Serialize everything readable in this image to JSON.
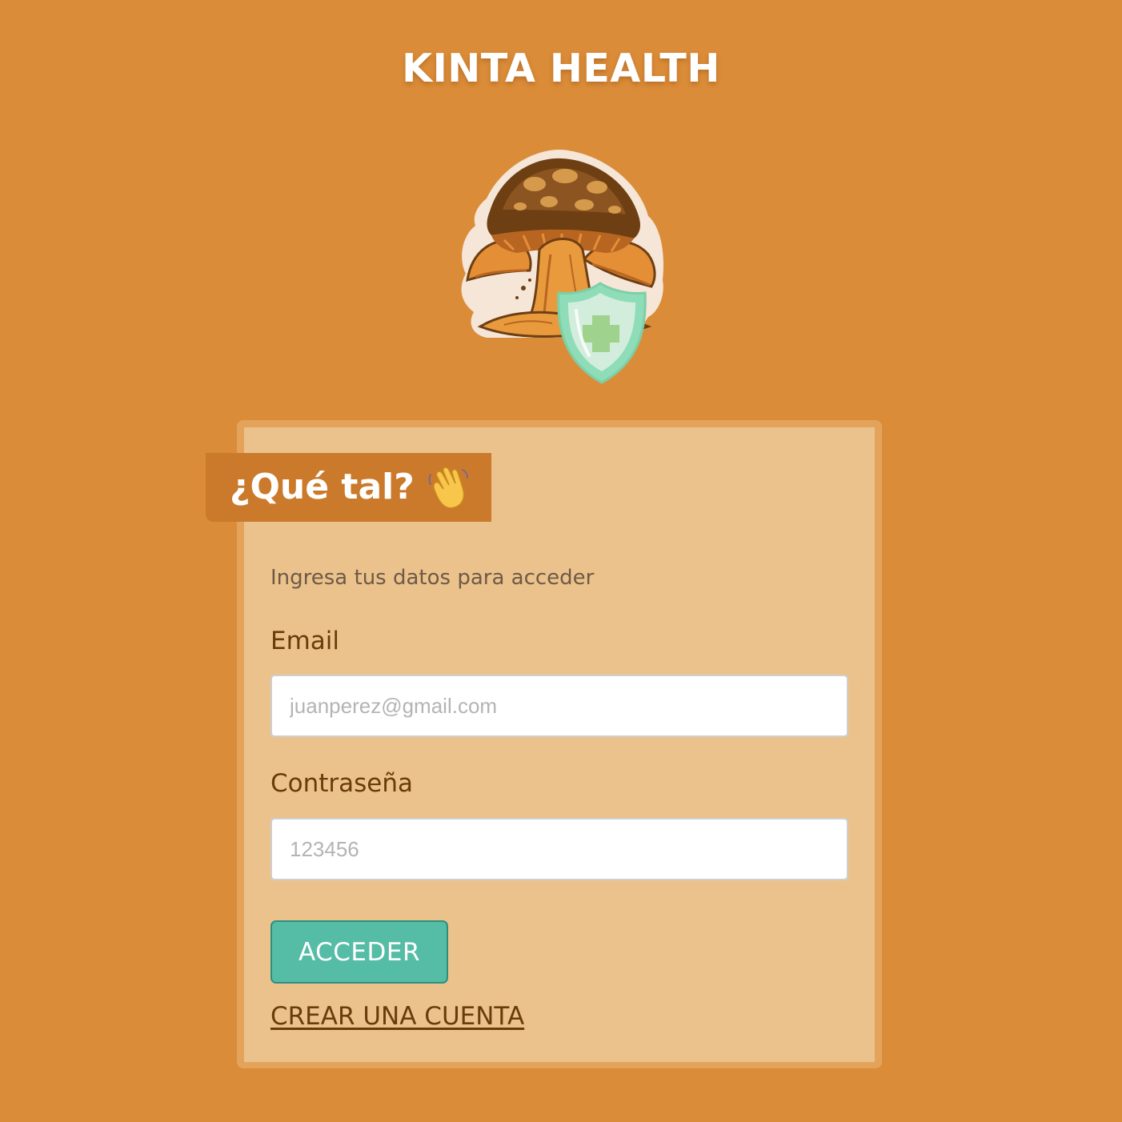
{
  "app": {
    "title": "KINTA HEALTH"
  },
  "logo": {
    "icon": "mushroom-shield-logo",
    "colors": {
      "outline": "#f6e6d8",
      "cap": "#6e3f12",
      "cap_spots": "#d59a4b",
      "gills": "#b86522",
      "stem": "#e99a3d",
      "shield": "#8fdcb8",
      "shield_inner": "#d2eddc",
      "cross": "#9fd28c"
    }
  },
  "login": {
    "greeting": "¿Qué tal?",
    "greeting_icon": "waving-hand-icon",
    "subtitle": "Ingresa tus datos para acceder",
    "email": {
      "label": "Email",
      "placeholder": "juanperez@gmail.com",
      "value": ""
    },
    "password": {
      "label": "Contraseña",
      "placeholder": "123456",
      "value": ""
    },
    "submit_label": "ACCEDER",
    "create_account_label": "CREAR UNA CUENTA"
  },
  "colors": {
    "background": "#db8c38",
    "card": "#ebc28c",
    "card_frame": "#e4a35b",
    "greeting_bg": "#cb7a2b",
    "label_text": "#6a3c0c",
    "subtitle_text": "#6e5a45",
    "button": "#55bca6",
    "button_border": "#2f8f7e"
  }
}
